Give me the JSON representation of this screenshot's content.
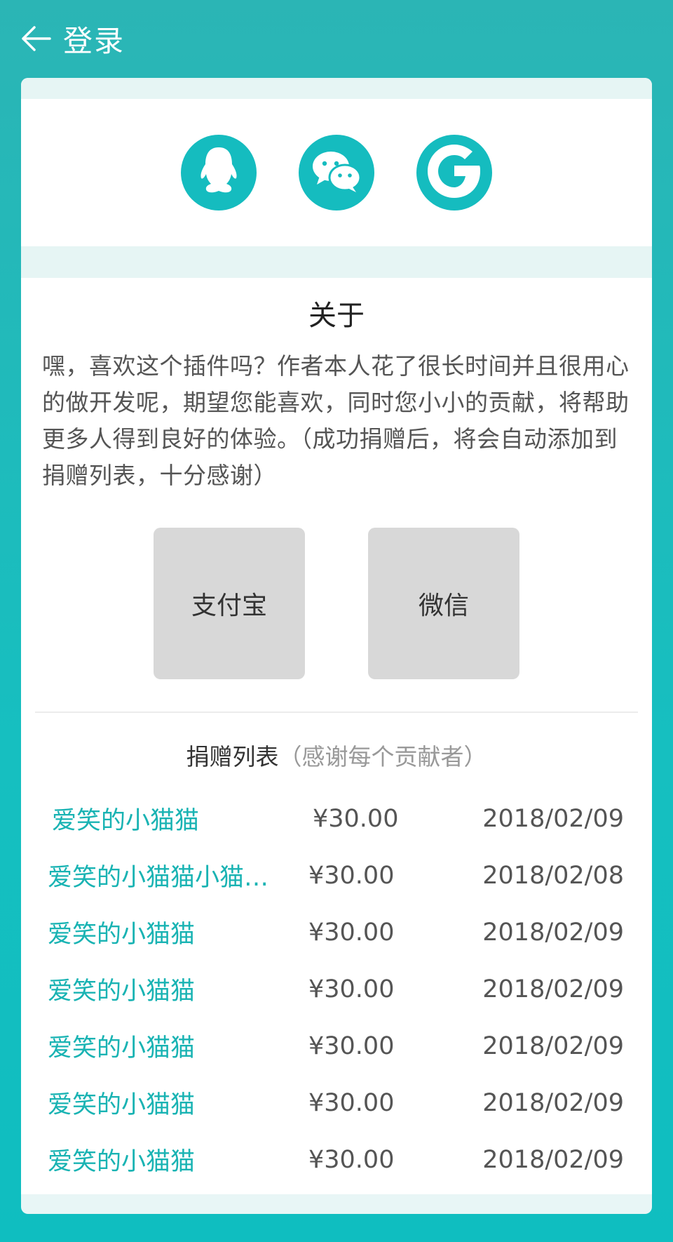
{
  "header": {
    "title": "登录",
    "back_icon": "arrow-left-icon"
  },
  "social_logins": [
    {
      "name": "qq",
      "icon": "qq-penguin-icon"
    },
    {
      "name": "wechat",
      "icon": "wechat-icon"
    },
    {
      "name": "google",
      "icon": "google-g-icon"
    }
  ],
  "about": {
    "title": "关于",
    "text": "嘿，喜欢这个插件吗？作者本人花了很长时间并且很用心的做开发呢，期望您能喜欢，同时您小小的贡献，将帮助更多人得到良好的体验。（成功捐赠后，将会自动添加到捐赠列表，十分感谢）"
  },
  "payment": {
    "alipay_label": "支付宝",
    "wechat_label": "微信"
  },
  "donations": {
    "title": "捐赠列表",
    "subtitle": "（感谢每个贡献者）",
    "rows": [
      {
        "name": "爱笑的小猫猫",
        "amount": "¥30.00",
        "date": "2018/02/09"
      },
      {
        "name": "爱笑的小猫猫小猫…",
        "amount": "¥30.00",
        "date": "2018/02/08"
      },
      {
        "name": "爱笑的小猫猫",
        "amount": "¥30.00",
        "date": "2018/02/09"
      },
      {
        "name": "爱笑的小猫猫",
        "amount": "¥30.00",
        "date": "2018/02/09"
      },
      {
        "name": "爱笑的小猫猫",
        "amount": "¥30.00",
        "date": "2018/02/09"
      },
      {
        "name": "爱笑的小猫猫",
        "amount": "¥30.00",
        "date": "2018/02/09"
      },
      {
        "name": "爱笑的小猫猫",
        "amount": "¥30.00",
        "date": "2018/02/09"
      }
    ]
  },
  "colors": {
    "primary": "#15bcbf",
    "background": "#2bb5b5",
    "button_gray": "#d8d8d8",
    "donor_name": "#19b3b3"
  }
}
